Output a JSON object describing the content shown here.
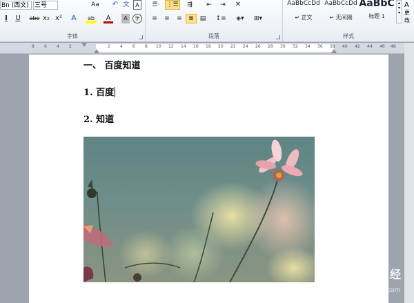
{
  "ribbon": {
    "font_group": {
      "label": "字体",
      "font_name": "Bn (西文)",
      "font_size": "三号",
      "grow_font": "Aa",
      "clear_format": "A",
      "buttons": [
        "U",
        "abe",
        "x₂",
        "x²",
        "A",
        "ab",
        "A",
        "A",
        "字"
      ]
    },
    "paragraph_group": {
      "label": "段落"
    },
    "styles_group": {
      "label": "样式",
      "items": [
        {
          "preview": "AaBbCcDd",
          "name": "↵ 正文"
        },
        {
          "preview": "AaBbCcDd",
          "name": "↵ 无间隔"
        },
        {
          "preview": "AaBbC",
          "name": "标题 1"
        }
      ],
      "change_styles": "更改"
    }
  },
  "ruler": {
    "left_ticks": [
      "8",
      "6",
      "4",
      "2"
    ],
    "right_ticks": [
      "2",
      "4",
      "6",
      "8",
      "10",
      "12",
      "14",
      "16",
      "18",
      "20",
      "22",
      "24",
      "26",
      "28",
      "30",
      "32",
      "34",
      "36",
      "38",
      "40",
      "42",
      "44",
      "46",
      "48"
    ]
  },
  "document": {
    "heading1": "一、  百度知道",
    "item1": "1.  百度",
    "item2": "2.  知道"
  },
  "watermark": {
    "brand": "Bai  经验",
    "url": "jingyan.baidu.com"
  }
}
